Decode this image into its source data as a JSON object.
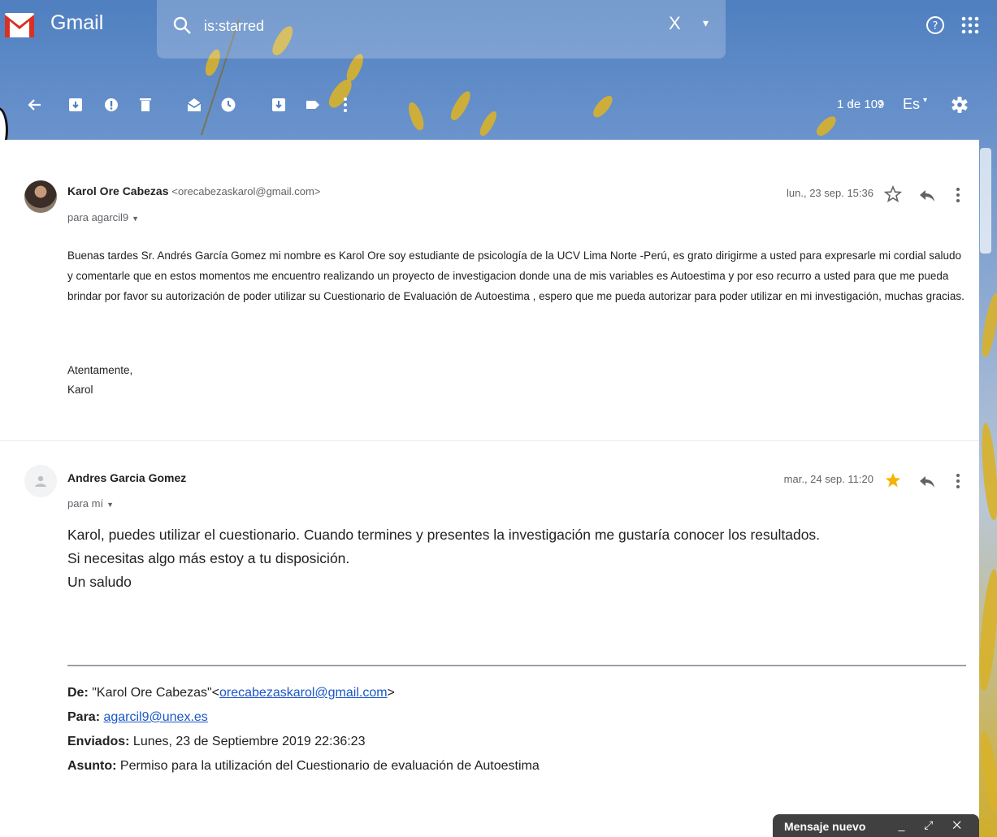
{
  "app": {
    "name": "Gmail"
  },
  "search": {
    "query": "is:starred",
    "clear_label": "X",
    "options_label": "▾"
  },
  "toolbar": {
    "pagination": "1 de 109",
    "prev_label": "‹",
    "next_label": "›",
    "language": "Es",
    "language_dropdown": "▾"
  },
  "messages": [
    {
      "sender_name": "Karol Ore Cabezas",
      "sender_email": "<orecabezaskarol@gmail.com>",
      "recipient": "para agarcil9",
      "date": "lun., 23 sep. 15:36",
      "starred": false,
      "body": "Buenas tardes Sr. Andrés García Gomez mi nombre es Karol Ore soy estudiante de psicología de la UCV Lima Norte -Perú, es grato dirigirme a usted para expresarle mi cordial saludo y comentarle que en estos momentos me encuentro realizando un proyecto de investigacion donde una de mis variables es Autoestima y por eso recurro a usted para que me pueda brindar por favor su autorización de poder utilizar su Cuestionario de Evaluación de Autoestima , espero que me pueda autorizar para poder utilizar en mi investigación, muchas gracias.",
      "closing": "Atentamente,",
      "signature": "Karol"
    },
    {
      "sender_name": "Andres Garcia Gomez",
      "sender_email": "",
      "recipient": "para mí",
      "date": "mar., 24 sep. 11:20",
      "starred": true,
      "lines": [
        "Karol, puedes utilizar el cuestionario. Cuando termines y presentes la investigación me gustaría conocer los resultados.",
        "Si necesitas algo más estoy a tu disposición.",
        "Un saludo"
      ],
      "quoted": {
        "from_label": "De:",
        "from_name": "\"Karol Ore Cabezas\"",
        "from_email": "orecabezaskarol@gmail.com",
        "to_label": "Para:",
        "to_email": "agarcil9@unex.es",
        "sent_label": "Enviados:",
        "sent_value": "Lunes, 23 de Septiembre 2019 22:36:23",
        "subject_label": "Asunto:",
        "subject_value": "Permiso para la utilización del Cuestionario de evaluación de Autoestima"
      }
    }
  ],
  "compose": {
    "title": "Mensaje nuevo",
    "controls": "_ ⤢ ✕"
  },
  "colors": {
    "gmail_red": "#d93025",
    "star_yellow": "#f4b400",
    "link_blue": "#1a56c8"
  }
}
